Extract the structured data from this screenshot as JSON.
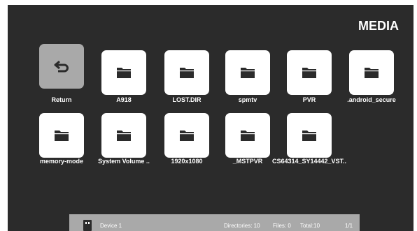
{
  "header": {
    "title": "MEDIA"
  },
  "items": [
    {
      "label": "Return",
      "icon": "return-icon",
      "selected": true
    },
    {
      "label": "A918",
      "icon": "folder-icon"
    },
    {
      "label": "LOST.DIR",
      "icon": "folder-icon"
    },
    {
      "label": "spmtv",
      "icon": "folder-icon"
    },
    {
      "label": "PVR",
      "icon": "folder-icon"
    },
    {
      "label": ".android_secure",
      "icon": "folder-icon"
    },
    {
      "label": "memory-mode",
      "icon": "folder-icon"
    },
    {
      "label": "System Volume ..",
      "icon": "folder-icon"
    },
    {
      "label": "1920x1080",
      "icon": "folder-icon"
    },
    {
      "label": "_MSTPVR",
      "icon": "folder-icon"
    },
    {
      "label": "CS64314_SY14442_VST..",
      "icon": "folder-icon"
    }
  ],
  "status_bar": {
    "device_icon": "usb-drive-icon",
    "device": "Device 1",
    "directories": "Directories: 10",
    "files": "Files:  0",
    "total": "Total:10",
    "page": "1/1"
  },
  "colors": {
    "background": "#2b2b2b",
    "tile": "#ffffff",
    "tile_selected": "#a9a9a9",
    "icon": "#2b2b2b",
    "status_bar": "#a9a9a9"
  }
}
